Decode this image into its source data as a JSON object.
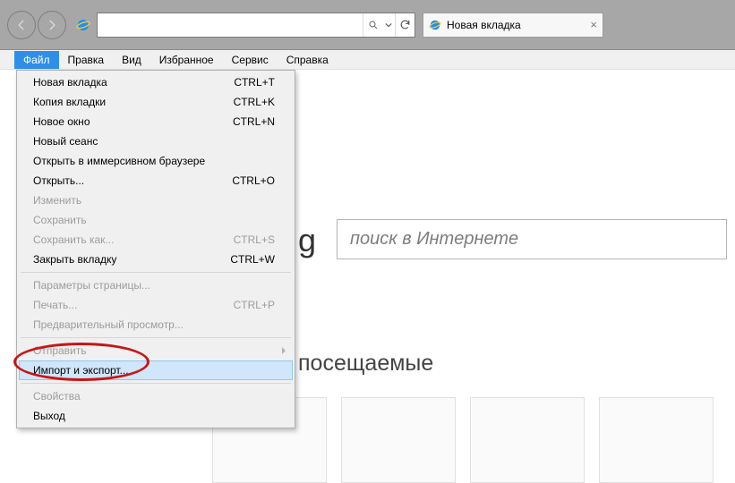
{
  "toolbar": {
    "address": "",
    "tab_title": "Новая вкладка"
  },
  "menubar": {
    "items": [
      "Файл",
      "Правка",
      "Вид",
      "Избранное",
      "Сервис",
      "Справка"
    ]
  },
  "dropdown": {
    "items": [
      {
        "label": "Новая вкладка",
        "shortcut": "CTRL+T"
      },
      {
        "label": "Копия вкладки",
        "shortcut": "CTRL+K"
      },
      {
        "label": "Новое окно",
        "shortcut": "CTRL+N"
      },
      {
        "label": "Новый сеанс"
      },
      {
        "label": "Открыть в иммерсивном браузере"
      },
      {
        "label": "Открыть...",
        "shortcut": "CTRL+O"
      },
      {
        "label": "Изменить",
        "disabled": true
      },
      {
        "label": "Сохранить",
        "disabled": true
      },
      {
        "label": "Сохранить как...",
        "shortcut": "CTRL+S",
        "disabled": true
      },
      {
        "label": "Закрыть вкладку",
        "shortcut": "CTRL+W"
      },
      {
        "sep": true
      },
      {
        "label": "Параметры страницы...",
        "disabled": true
      },
      {
        "label": "Печать...",
        "shortcut": "CTRL+P",
        "disabled": true
      },
      {
        "label": "Предварительный просмотр...",
        "disabled": true
      },
      {
        "sep": true
      },
      {
        "label": "Отправить",
        "disabled": true,
        "submenu": true
      },
      {
        "label": "Импорт и экспорт...",
        "highlight": true
      },
      {
        "sep": true
      },
      {
        "label": "Свойства",
        "disabled": true
      },
      {
        "label": "Выход"
      }
    ]
  },
  "page": {
    "bing_fragment": "g",
    "search_placeholder": "поиск в Интернете",
    "heading_fragment": "посещаемые"
  }
}
